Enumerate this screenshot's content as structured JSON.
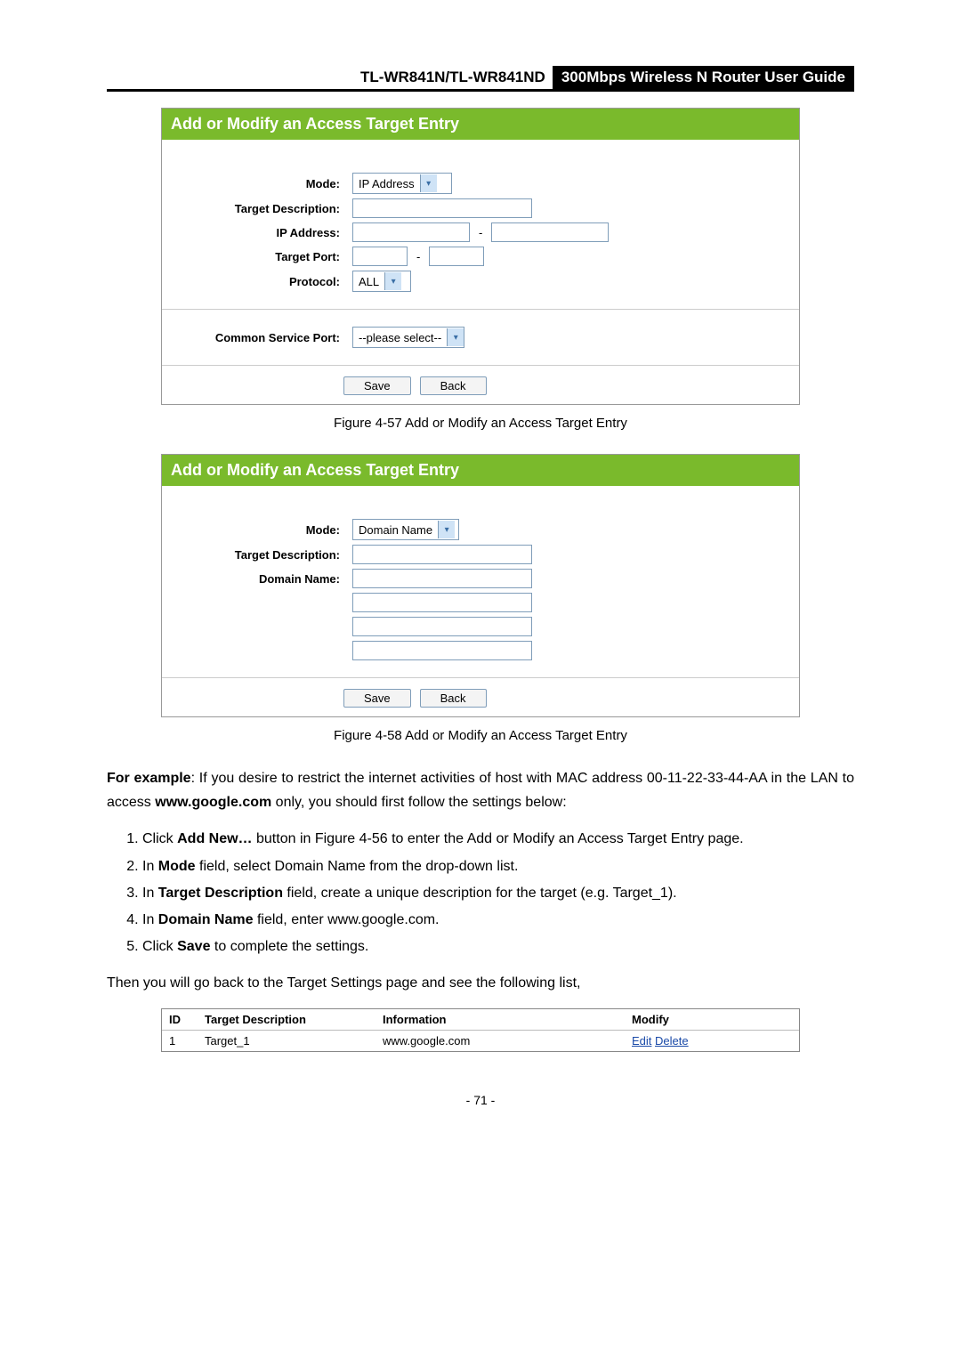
{
  "header": {
    "model": "TL-WR841N/TL-WR841ND",
    "subtitle": "300Mbps Wireless N Router User Guide"
  },
  "panel1": {
    "title": "Add or Modify an Access Target Entry",
    "labels": {
      "mode": "Mode:",
      "target_desc": "Target Description:",
      "ip_addr": "IP Address:",
      "target_port": "Target Port:",
      "protocol": "Protocol:",
      "common_port": "Common Service Port:"
    },
    "values": {
      "mode": "IP Address",
      "protocol": "ALL",
      "common_port": "--please select--"
    },
    "buttons": {
      "save": "Save",
      "back": "Back"
    }
  },
  "caption1": "Figure 4-57    Add or Modify an Access Target Entry",
  "panel2": {
    "title": "Add or Modify an Access Target Entry",
    "labels": {
      "mode": "Mode:",
      "target_desc": "Target Description:",
      "domain": "Domain Name:"
    },
    "values": {
      "mode": "Domain Name"
    },
    "buttons": {
      "save": "Save",
      "back": "Back"
    }
  },
  "caption2": "Figure 4-58    Add or Modify an Access Target Entry",
  "para1": {
    "lead": "For example",
    "text1": ": If you desire to restrict the internet activities of host with MAC address 00-11-22-33-44-AA in the LAN to access ",
    "bold1": "www.google.com",
    "text2": " only, you should first follow the settings below:"
  },
  "steps": {
    "s1a": "Click ",
    "s1b": "Add New…",
    "s1c": " button in Figure 4-56 to enter the Add or Modify an Access Target Entry page.",
    "s2a": "In ",
    "s2b": "Mode",
    "s2c": " field, select Domain Name from the drop-down list.",
    "s3a": "In ",
    "s3b": "Target Description",
    "s3c": " field, create a unique description for the target (e.g. Target_1).",
    "s4a": "In ",
    "s4b": "Domain Name",
    "s4c": " field, enter www.google.com.",
    "s5a": "Click ",
    "s5b": "Save",
    "s5c": " to complete the settings."
  },
  "para2": "Then you will go back to the Target Settings page and see the following list,",
  "table": {
    "headers": {
      "id": "ID",
      "desc": "Target Description",
      "info": "Information",
      "mod": "Modify"
    },
    "row": {
      "id": "1",
      "desc": "Target_1",
      "info": "www.google.com",
      "edit": "Edit",
      "delete": "Delete"
    }
  },
  "pagenum": "- 71 -"
}
